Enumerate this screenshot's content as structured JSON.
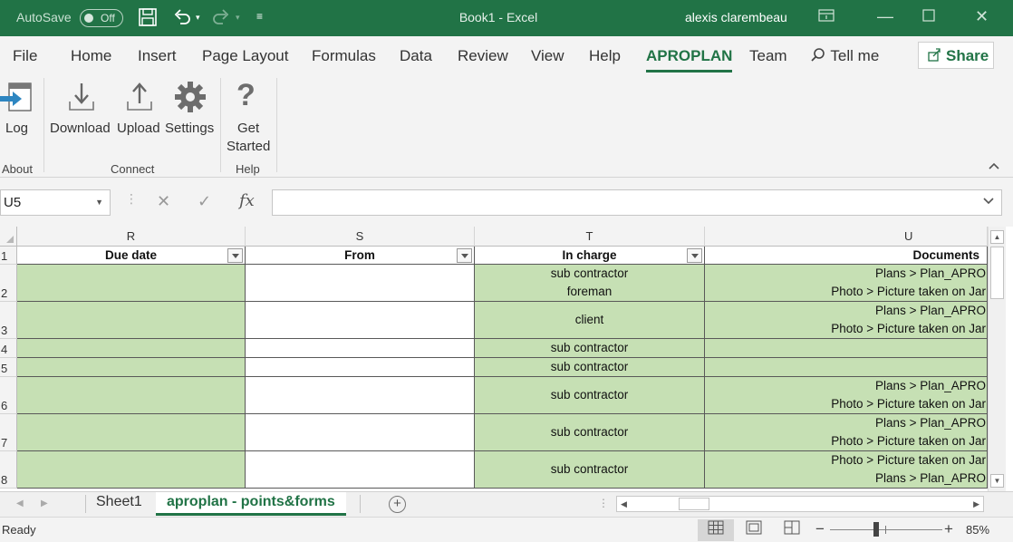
{
  "titlebar": {
    "autosave_label": "AutoSave",
    "autosave_state": "Off",
    "doc_title": "Book1  -  Excel",
    "user": "alexis clarembeau"
  },
  "ribbon_tabs": [
    "File",
    "Home",
    "Insert",
    "Page Layout",
    "Formulas",
    "Data",
    "Review",
    "View",
    "Help",
    "APROPLAN",
    "Team"
  ],
  "active_tab": "APROPLAN",
  "tell_me": "Tell me",
  "share": "Share",
  "ribbon": {
    "log": "Log",
    "download": "Download",
    "upload": "Upload",
    "settings": "Settings",
    "get": "Get",
    "started": "Started",
    "groups": {
      "about": "About",
      "connect": "Connect",
      "help": "Help"
    }
  },
  "namebox": "U5",
  "formula_value": "",
  "columns": [
    "R",
    "S",
    "T",
    "U"
  ],
  "headers": [
    "Due date",
    "From",
    "In charge",
    "Documents"
  ],
  "rows": [
    {
      "num": "2",
      "in_charge": [
        "sub contractor",
        "foreman"
      ],
      "documents": [
        "Plans > Plan_APRO",
        "Photo > Picture taken on Jar"
      ]
    },
    {
      "num": "3",
      "in_charge": [
        "client"
      ],
      "documents": [
        "Plans > Plan_APRO",
        "Photo > Picture taken on Jar"
      ]
    },
    {
      "num": "4",
      "in_charge": [
        "sub contractor"
      ],
      "documents": []
    },
    {
      "num": "5",
      "in_charge": [
        "sub contractor"
      ],
      "documents": []
    },
    {
      "num": "6",
      "in_charge": [
        "sub contractor"
      ],
      "documents": [
        "Plans > Plan_APRO",
        "Photo > Picture taken on Jar"
      ]
    },
    {
      "num": "7",
      "in_charge": [
        "sub contractor"
      ],
      "documents": [
        "Plans > Plan_APRO",
        "Photo > Picture taken on Jar"
      ]
    },
    {
      "num": "8",
      "in_charge": [
        "sub contractor"
      ],
      "documents": [
        "Photo > Picture taken on Jar",
        "Plans > Plan_APRO"
      ]
    }
  ],
  "sheets": [
    "Sheet1",
    "aproplan - points&forms"
  ],
  "active_sheet": "aproplan - points&forms",
  "status": {
    "ready": "Ready",
    "zoom": "85%"
  },
  "colors": {
    "excel_green": "#217346",
    "cell_green": "#c6e0b4"
  }
}
